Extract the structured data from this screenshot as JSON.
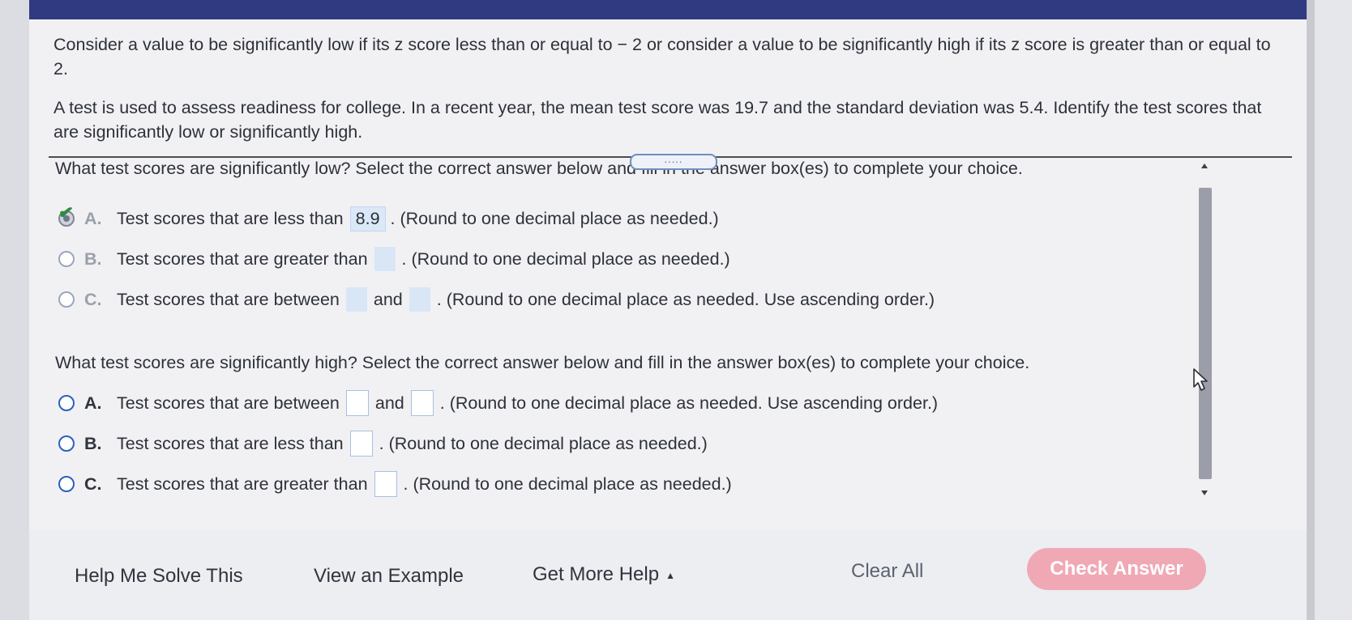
{
  "intro": {
    "paragraph1": "Consider a value to be significantly low if its z score less than or equal to  − 2 or consider a value to be significantly high if its z score is greater than or equal to 2.",
    "paragraph2": "A test is used to assess readiness for college. In a recent year, the mean test score was 19.7 and the standard deviation was 5.4. Identify the test scores that are significantly low or significantly high."
  },
  "drag_handle": ".....",
  "question_low": {
    "prompt": "What test scores are significantly low? Select the correct answer below and fill in the answer box(es) to complete your choice.",
    "options": [
      {
        "letter": "A.",
        "text_before": "Test scores that are less than",
        "answer": "8.9",
        "text_after": ". (Round to one decimal place as needed.)"
      },
      {
        "letter": "B.",
        "text_before": "Test scores that are greater than",
        "text_after": ". (Round to one decimal place as needed.)"
      },
      {
        "letter": "C.",
        "text_before": "Test scores that are between",
        "text_mid": "and",
        "text_after": ". (Round to one decimal place as needed. Use ascending order.)"
      }
    ]
  },
  "question_high": {
    "prompt": "What test scores are significantly high? Select the correct answer below and fill in the answer box(es) to complete your choice.",
    "options": [
      {
        "letter": "A.",
        "text_before": "Test scores that are between",
        "text_mid": "and",
        "text_after": ". (Round to one decimal place as needed. Use ascending order.)"
      },
      {
        "letter": "B.",
        "text_before": "Test scores that are less than",
        "text_after": ". (Round to one decimal place as needed.)"
      },
      {
        "letter": "C.",
        "text_before": "Test scores that are greater than",
        "text_after": ". (Round to one decimal place as needed.)"
      }
    ]
  },
  "footer": {
    "help_me_solve": "Help Me Solve This",
    "view_example": "View an Example",
    "get_more_help": "Get More Help",
    "clear_all": "Clear All",
    "check_answer": "Check Answer"
  },
  "colors": {
    "header_bar": "#2f3a80",
    "check_answer_bg": "#f0a8b5",
    "correct_check": "#2e8b3e",
    "radio_accent": "#2d5fbf"
  }
}
